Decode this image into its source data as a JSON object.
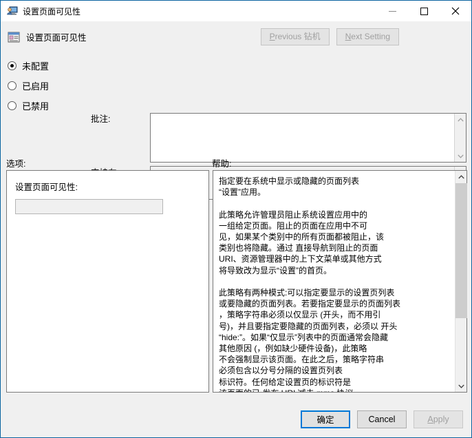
{
  "window": {
    "title": "设置页面可见性",
    "icon": "computer-user-icon",
    "controls": {
      "minimize": "minimize-icon",
      "maximize": "maximize-icon",
      "close": "close-icon"
    }
  },
  "header": {
    "icon": "policy-setting-icon",
    "title": "设置页面可见性",
    "previous_button": {
      "accel": "P",
      "rest": "revious 钻机",
      "full": "Previous 钻机",
      "disabled": true
    },
    "next_button": {
      "accel": "N",
      "rest": "ext Setting",
      "full": "Next Setting",
      "disabled": true
    }
  },
  "state_options": [
    {
      "label": "未配置",
      "checked": true
    },
    {
      "label": "已启用",
      "checked": false
    },
    {
      "label": "已禁用",
      "checked": false
    }
  ],
  "fields": {
    "comment_label": "批注:",
    "comment_value": "",
    "supported_label": "支持在:",
    "supported_value": ""
  },
  "sections": {
    "options_label": "选项:",
    "help_label": "帮助:"
  },
  "options_pane": {
    "setting_label": "设置页面可见性:",
    "setting_value": "",
    "setting_placeholder": ""
  },
  "help_pane": {
    "text": "指定要在系统中显示或隐藏的页面列表\n“设置”应用。\n\n此策略允许管理员阻止系统设置应用中的\n一组给定页面。阻止的页面在应用中不可\n见，如果某个类别中的所有页面都被阻止，该\n类别也将隐藏。通过 直接导航到阻止的页面\nURI、资源管理器中的上下文菜单或其他方式\n将导致改为显示“设置”的首页。\n\n此策略有两种模式:可以指定要显示的设置页列表\n或要隐藏的页面列表。若要指定要显示的页面列表\n，策略字符串必须以仅显示 (开头，而不用引\n号)，并且要指定要隐藏的页面列表，必须以 开头\n“hide:”。如果“仅显示”列表中的页面通常会隐藏\n其他原因 (，例如缺少硬件设备)，此策略\n不会强制显示该页面。在此之后，策略字符串\n必须包含以分号分隔的设置页列表\n标识符。任何给定设置页的标识符是\n该页面的已 发布 URI 减去 mms 协议\n部分。"
  },
  "footer": {
    "ok_label": "确定",
    "cancel_label": "Cancel",
    "apply_accel": "A",
    "apply_rest": "pply",
    "apply_full": "Apply",
    "apply_disabled": true
  },
  "colors": {
    "window_border": "#0a64a0",
    "default_button_border": "#0078d7",
    "face": "#f0f0f0"
  }
}
